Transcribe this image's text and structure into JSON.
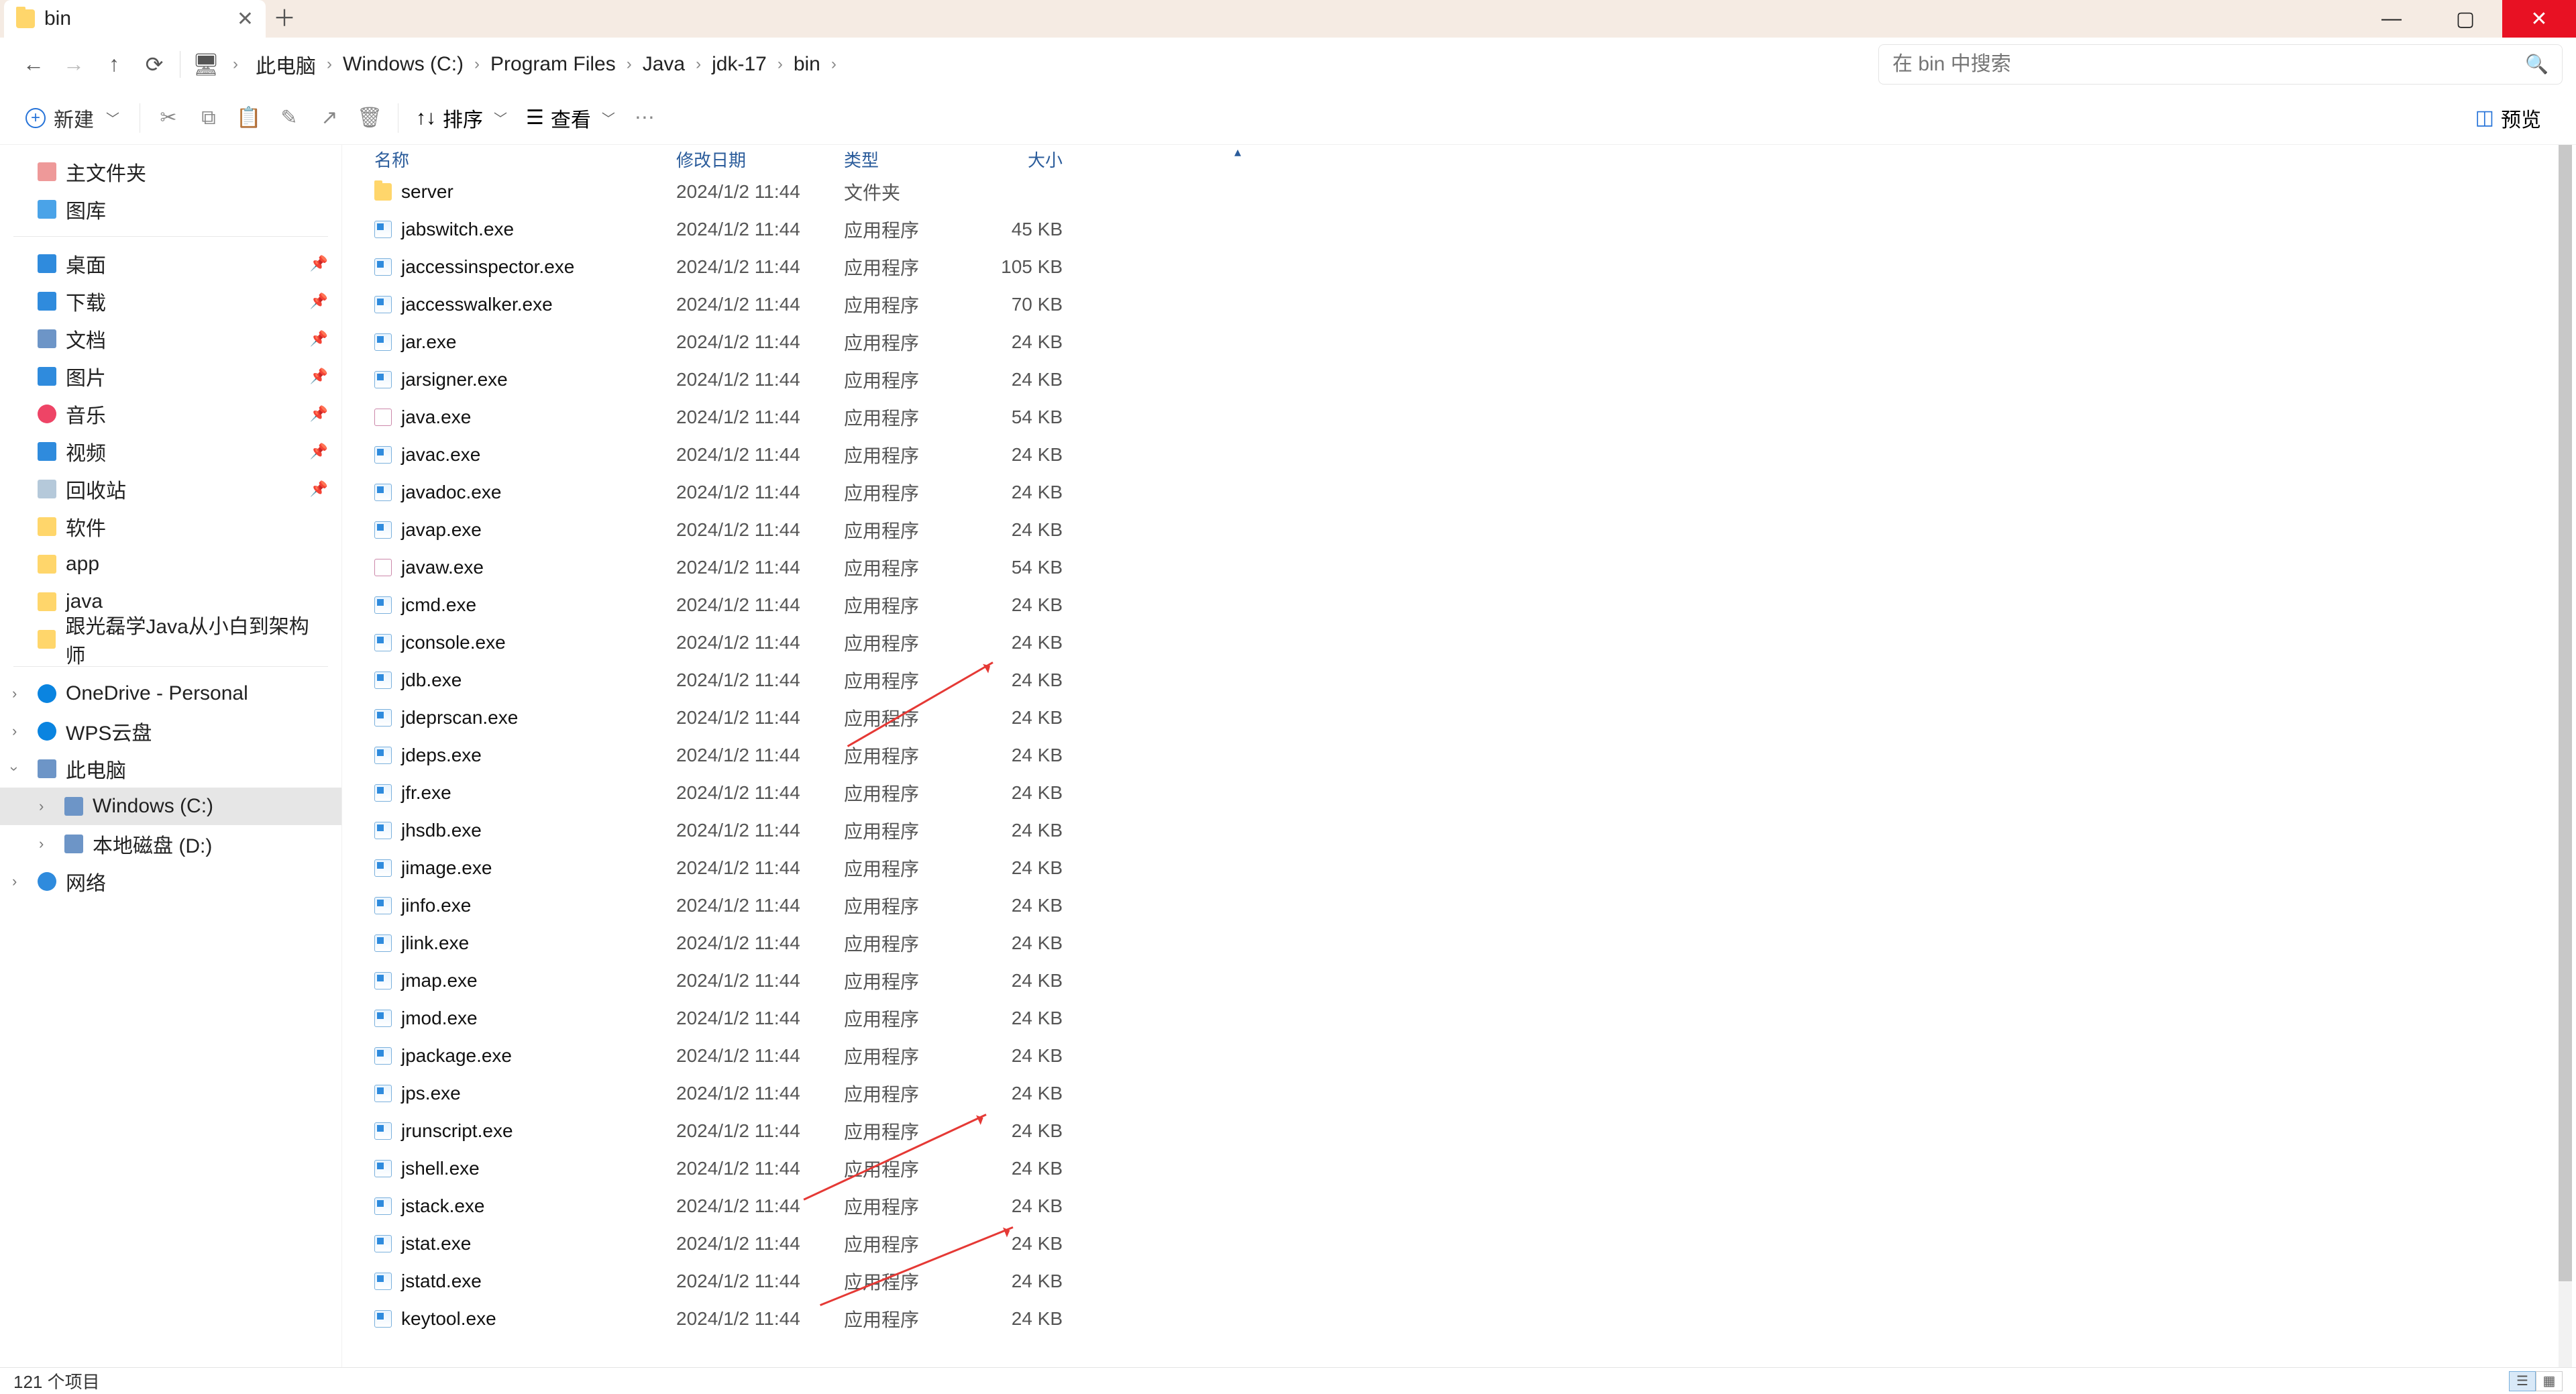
{
  "titlebar": {
    "tab_title": "bin"
  },
  "breadcrumbs": [
    "此电脑",
    "Windows (C:)",
    "Program Files",
    "Java",
    "jdk-17",
    "bin"
  ],
  "search": {
    "placeholder": "在 bin 中搜索"
  },
  "toolbar": {
    "new_label": "新建",
    "sort_label": "排序",
    "view_label": "查看",
    "preview_label": "预览"
  },
  "sidebar": {
    "home": "主文件夹",
    "gallery": "图库",
    "quick": [
      {
        "label": "桌面",
        "icon": "ic-desktop",
        "pin": true
      },
      {
        "label": "下载",
        "icon": "ic-download",
        "pin": true
      },
      {
        "label": "文档",
        "icon": "ic-docs",
        "pin": true
      },
      {
        "label": "图片",
        "icon": "ic-images",
        "pin": true
      },
      {
        "label": "音乐",
        "icon": "ic-music",
        "pin": true
      },
      {
        "label": "视频",
        "icon": "ic-video",
        "pin": true
      },
      {
        "label": "回收站",
        "icon": "ic-bin",
        "pin": true
      },
      {
        "label": "软件",
        "icon": "ic-folder",
        "pin": false
      },
      {
        "label": "app",
        "icon": "ic-folder",
        "pin": false
      },
      {
        "label": "java",
        "icon": "ic-folder",
        "pin": false
      },
      {
        "label": "跟光磊学Java从小白到架构师",
        "icon": "ic-folder",
        "pin": false
      }
    ],
    "cloud": [
      {
        "label": "OneDrive - Personal",
        "icon": "ic-onedrive",
        "chev": true
      },
      {
        "label": "WPS云盘",
        "icon": "ic-wps",
        "chev": true
      }
    ],
    "pc_label": "此电脑",
    "drives": [
      {
        "label": "Windows (C:)",
        "icon": "ic-cdrive",
        "selected": true
      },
      {
        "label": "本地磁盘 (D:)",
        "icon": "ic-ddrive",
        "selected": false
      }
    ],
    "network": "网络"
  },
  "columns": {
    "name": "名称",
    "date": "修改日期",
    "type": "类型",
    "size": "大小"
  },
  "files": [
    {
      "name": "server",
      "date": "2024/1/2 11:44",
      "type": "文件夹",
      "size": "",
      "icon": "fic-folder"
    },
    {
      "name": "jabswitch.exe",
      "date": "2024/1/2 11:44",
      "type": "应用程序",
      "size": "45 KB",
      "icon": "fic-exe"
    },
    {
      "name": "jaccessinspector.exe",
      "date": "2024/1/2 11:44",
      "type": "应用程序",
      "size": "105 KB",
      "icon": "fic-exe"
    },
    {
      "name": "jaccesswalker.exe",
      "date": "2024/1/2 11:44",
      "type": "应用程序",
      "size": "70 KB",
      "icon": "fic-exe"
    },
    {
      "name": "jar.exe",
      "date": "2024/1/2 11:44",
      "type": "应用程序",
      "size": "24 KB",
      "icon": "fic-exe"
    },
    {
      "name": "jarsigner.exe",
      "date": "2024/1/2 11:44",
      "type": "应用程序",
      "size": "24 KB",
      "icon": "fic-exe"
    },
    {
      "name": "java.exe",
      "date": "2024/1/2 11:44",
      "type": "应用程序",
      "size": "54 KB",
      "icon": "fic-java"
    },
    {
      "name": "javac.exe",
      "date": "2024/1/2 11:44",
      "type": "应用程序",
      "size": "24 KB",
      "icon": "fic-exe"
    },
    {
      "name": "javadoc.exe",
      "date": "2024/1/2 11:44",
      "type": "应用程序",
      "size": "24 KB",
      "icon": "fic-exe"
    },
    {
      "name": "javap.exe",
      "date": "2024/1/2 11:44",
      "type": "应用程序",
      "size": "24 KB",
      "icon": "fic-exe"
    },
    {
      "name": "javaw.exe",
      "date": "2024/1/2 11:44",
      "type": "应用程序",
      "size": "54 KB",
      "icon": "fic-java"
    },
    {
      "name": "jcmd.exe",
      "date": "2024/1/2 11:44",
      "type": "应用程序",
      "size": "24 KB",
      "icon": "fic-exe"
    },
    {
      "name": "jconsole.exe",
      "date": "2024/1/2 11:44",
      "type": "应用程序",
      "size": "24 KB",
      "icon": "fic-exe"
    },
    {
      "name": "jdb.exe",
      "date": "2024/1/2 11:44",
      "type": "应用程序",
      "size": "24 KB",
      "icon": "fic-exe"
    },
    {
      "name": "jdeprscan.exe",
      "date": "2024/1/2 11:44",
      "type": "应用程序",
      "size": "24 KB",
      "icon": "fic-exe"
    },
    {
      "name": "jdeps.exe",
      "date": "2024/1/2 11:44",
      "type": "应用程序",
      "size": "24 KB",
      "icon": "fic-exe"
    },
    {
      "name": "jfr.exe",
      "date": "2024/1/2 11:44",
      "type": "应用程序",
      "size": "24 KB",
      "icon": "fic-exe"
    },
    {
      "name": "jhsdb.exe",
      "date": "2024/1/2 11:44",
      "type": "应用程序",
      "size": "24 KB",
      "icon": "fic-exe"
    },
    {
      "name": "jimage.exe",
      "date": "2024/1/2 11:44",
      "type": "应用程序",
      "size": "24 KB",
      "icon": "fic-exe"
    },
    {
      "name": "jinfo.exe",
      "date": "2024/1/2 11:44",
      "type": "应用程序",
      "size": "24 KB",
      "icon": "fic-exe"
    },
    {
      "name": "jlink.exe",
      "date": "2024/1/2 11:44",
      "type": "应用程序",
      "size": "24 KB",
      "icon": "fic-exe"
    },
    {
      "name": "jmap.exe",
      "date": "2024/1/2 11:44",
      "type": "应用程序",
      "size": "24 KB",
      "icon": "fic-exe"
    },
    {
      "name": "jmod.exe",
      "date": "2024/1/2 11:44",
      "type": "应用程序",
      "size": "24 KB",
      "icon": "fic-exe"
    },
    {
      "name": "jpackage.exe",
      "date": "2024/1/2 11:44",
      "type": "应用程序",
      "size": "24 KB",
      "icon": "fic-exe"
    },
    {
      "name": "jps.exe",
      "date": "2024/1/2 11:44",
      "type": "应用程序",
      "size": "24 KB",
      "icon": "fic-exe"
    },
    {
      "name": "jrunscript.exe",
      "date": "2024/1/2 11:44",
      "type": "应用程序",
      "size": "24 KB",
      "icon": "fic-exe"
    },
    {
      "name": "jshell.exe",
      "date": "2024/1/2 11:44",
      "type": "应用程序",
      "size": "24 KB",
      "icon": "fic-exe"
    },
    {
      "name": "jstack.exe",
      "date": "2024/1/2 11:44",
      "type": "应用程序",
      "size": "24 KB",
      "icon": "fic-exe"
    },
    {
      "name": "jstat.exe",
      "date": "2024/1/2 11:44",
      "type": "应用程序",
      "size": "24 KB",
      "icon": "fic-exe"
    },
    {
      "name": "jstatd.exe",
      "date": "2024/1/2 11:44",
      "type": "应用程序",
      "size": "24 KB",
      "icon": "fic-exe"
    },
    {
      "name": "keytool.exe",
      "date": "2024/1/2 11:44",
      "type": "应用程序",
      "size": "24 KB",
      "icon": "fic-exe"
    }
  ],
  "status": {
    "count_label": "121 个项目"
  },
  "annotations": {
    "arrows_point_to": [
      "jconsole.exe",
      "jps.exe",
      "jstack.exe"
    ]
  }
}
